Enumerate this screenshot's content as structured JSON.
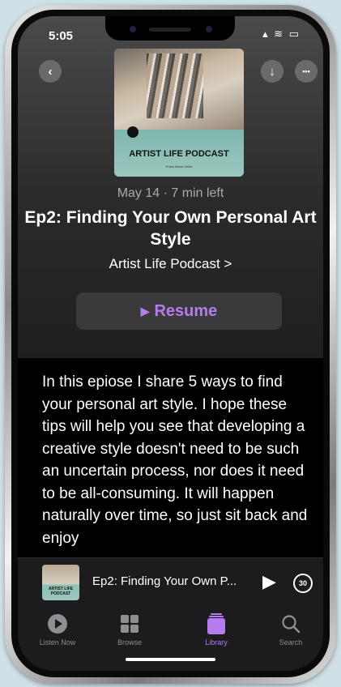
{
  "status_bar": {
    "time": "5:05",
    "icons": "▴ ≋ ▭"
  },
  "nav": {
    "back_icon": "chevron-left-icon",
    "back_glyph": "‹",
    "bookmark_glyph": "▯",
    "download_glyph": "↓",
    "more_glyph": "•••"
  },
  "artwork": {
    "title": "ARTIST LIFE PODCAST",
    "author": "Robin Marie Smith"
  },
  "episode": {
    "meta": "May 14 · 7 min left",
    "title": "Ep2: Finding Your Own Personal Art Style",
    "podcast": "Artist Life Podcast >",
    "resume_glyph": "▶",
    "resume_label": "Resume",
    "description": "In this epiose I share 5 ways to find your personal art style. I hope these tips will help you see that developing a creative style doesn't need to be such an uncertain process, nor does it need to be all-consuming. It will happen naturally over time, so just sit back and enjoy"
  },
  "mini_player": {
    "art_title": "ARTIST LIFE PODCAST",
    "title": "Ep2: Finding Your Own P...",
    "play_glyph": "▶",
    "skip_label": "30"
  },
  "tabs": [
    {
      "label": "Listen Now",
      "icon": "play-circle-icon"
    },
    {
      "label": "Browse",
      "icon": "grid-icon"
    },
    {
      "label": "Library",
      "icon": "library-icon"
    },
    {
      "label": "Search",
      "icon": "search-icon"
    }
  ],
  "colors": {
    "accent": "#b57cf0",
    "background": "#000000",
    "tab_inactive": "#8e8e93"
  }
}
